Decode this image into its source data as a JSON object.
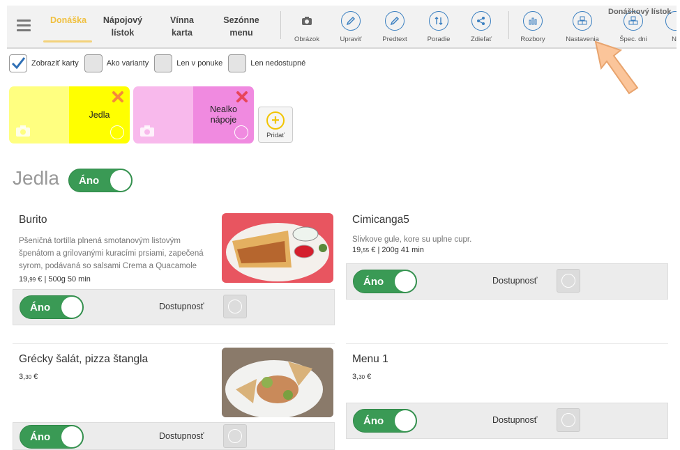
{
  "nav": {
    "tabs": [
      {
        "label": "Donáška",
        "active": true
      },
      {
        "label": "Nápojový\nlístok"
      },
      {
        "label": "Vínna\nkarta"
      },
      {
        "label": "Sezónne\nmenu"
      }
    ],
    "tools": [
      "Obrázok",
      "Upraviť",
      "Predtext",
      "Poradie",
      "Zdieľať",
      "Rozbory",
      "Nastavenia",
      "Špec. dni",
      "N"
    ],
    "corner_label": "Donáškový lístok"
  },
  "filters": [
    {
      "label": "Zobraziť karty",
      "checked": true
    },
    {
      "label": "Ako varianty",
      "checked": false
    },
    {
      "label": "Len v ponuke",
      "checked": false
    },
    {
      "label": "Len nedostupné",
      "checked": false
    }
  ],
  "categories": [
    {
      "name": "Jedla",
      "color_light": "#ffff80",
      "color": "#ffff00"
    },
    {
      "name": "Nealko\nnápoje",
      "color_light": "#f8b9ec",
      "color": "#f08ae0"
    }
  ],
  "add_label": "Pridať",
  "section": {
    "title": "Jedla",
    "toggle": "Áno"
  },
  "items": [
    {
      "name": "Burito",
      "desc": "Pšeničná tortilla plnená smotanovým listovým špenátom a grilovanými kuracími prsiami, zapečená syrom, podávaná so salsami Crema a Quacamole",
      "price_main": "19,",
      "price_cents": "99",
      "price_rest": "€  |  500g  50 min",
      "toggle": "Áno",
      "availability": "Dostupnosť"
    },
    {
      "name": "Cimicanga5",
      "desc": "Slivkove gule, kore su uplne cupr.",
      "price_main": "19,",
      "price_cents": "55",
      "price_rest": "€  |  200g  41 min",
      "toggle": "Áno",
      "availability": "Dostupnosť"
    },
    {
      "name": "Grécky šalát, pizza štangla",
      "desc": "",
      "price_main": "3,",
      "price_cents": "30",
      "price_rest": "€",
      "toggle": "Áno",
      "availability": "Dostupnosť"
    },
    {
      "name": "Menu 1",
      "desc": "",
      "price_main": "3,",
      "price_cents": "30",
      "price_rest": "€",
      "toggle": "Áno",
      "availability": "Dostupnosť"
    }
  ],
  "colors": {
    "accent": "#3a7fc0",
    "toggle_green": "#3a9a55",
    "active_tab": "#f0c040"
  }
}
